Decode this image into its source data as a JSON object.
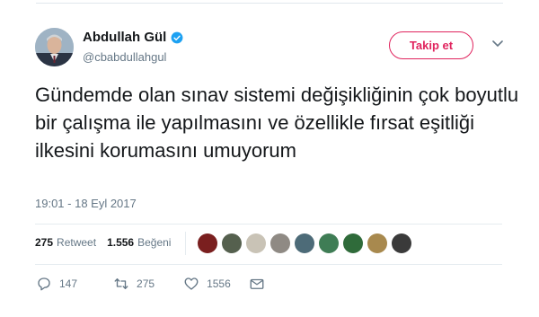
{
  "author": {
    "name": "Abdullah Gül",
    "handle": "@cbabdullahgul"
  },
  "follow_label": "Takip et",
  "tweet_text": "Gündemde olan sınav sistemi değişikliğinin çok boyutlu bir çalışma ile yapılmasını ve özellikle fırsat eşitliği ilkesini korumasını umuyorum",
  "timestamp": "19:01 - 18 Eyl 2017",
  "stats": {
    "retweets_count": "275",
    "retweets_label": "Retweet",
    "likes_count": "1.556",
    "likes_label": "Beğeni"
  },
  "actions": {
    "reply_count": "147",
    "retweet_count": "275",
    "like_count": "1556"
  },
  "colors": {
    "accent": "#e0245e",
    "verified": "#1da1f2",
    "muted": "#657786"
  },
  "icons": [
    "verified-badge-icon",
    "chevron-down-icon",
    "reply-icon",
    "retweet-icon",
    "like-icon",
    "direct-message-icon"
  ]
}
